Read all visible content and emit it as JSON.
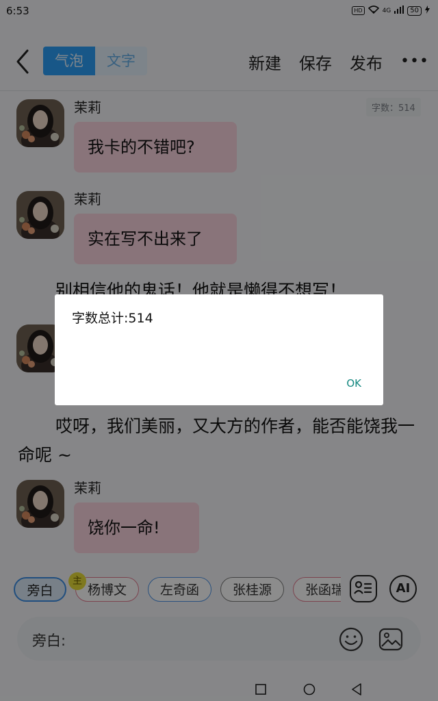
{
  "status": {
    "time": "6:53",
    "battery": "50",
    "hd": "HD",
    "signal": "4G"
  },
  "header": {
    "tabs": [
      {
        "label": "气泡"
      },
      {
        "label": "文字"
      }
    ],
    "new_label": "新建",
    "save_label": "保存",
    "publish_label": "发布",
    "more_label": "•••"
  },
  "word_count_badge": "字数：514",
  "messages": [
    {
      "sender": "茉莉",
      "text": "我卡的不错吧?"
    },
    {
      "sender": "茉莉",
      "text": "实在写不出来了"
    },
    {
      "sender": "茉莉",
      "text": "饶你一命!"
    }
  ],
  "narrations": [
    {
      "text": "别相信他的鬼话！他就是懒得不想写！"
    },
    {
      "text": "哎呀，我们美丽，又大方的作者，能否能饶我一命呢 ~"
    }
  ],
  "roles": [
    {
      "label": "旁白"
    },
    {
      "label": "杨博文",
      "badge": "主"
    },
    {
      "label": "左奇函"
    },
    {
      "label": "张桂源"
    },
    {
      "label": "张函瑞"
    }
  ],
  "ai_label": "AI",
  "input": {
    "label": "旁白:"
  },
  "dialog": {
    "message": "字数总计:514",
    "ok_label": "OK"
  }
}
